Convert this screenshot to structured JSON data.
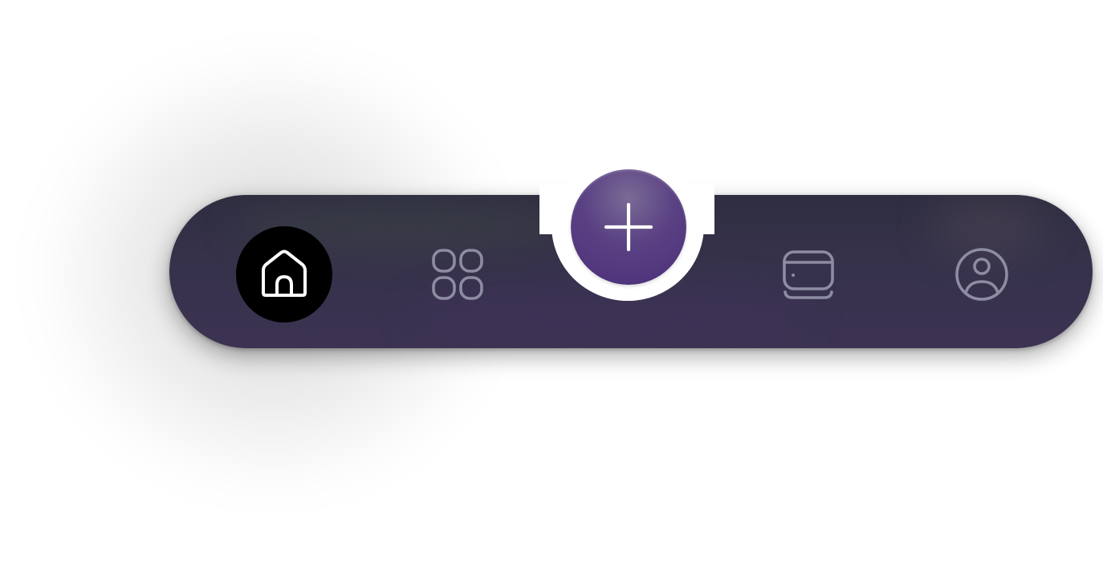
{
  "nav": {
    "items": [
      {
        "id": "home",
        "icon": "home-icon",
        "active": true
      },
      {
        "id": "apps",
        "icon": "grid-icon",
        "active": false
      },
      {
        "id": "wallet",
        "icon": "wallet-icon",
        "active": false
      },
      {
        "id": "profile",
        "icon": "user-circle-icon",
        "active": false
      }
    ],
    "fab": {
      "icon": "plus-icon"
    }
  },
  "colors": {
    "bar_top": "#2f2e41",
    "bar_bottom": "#3c3352",
    "active_bg": "#000000",
    "active_icon": "#ffffff",
    "inactive_icon": "#8d8ca3",
    "fab_top": "#7a6a96",
    "fab_bottom": "#4b2f79"
  }
}
